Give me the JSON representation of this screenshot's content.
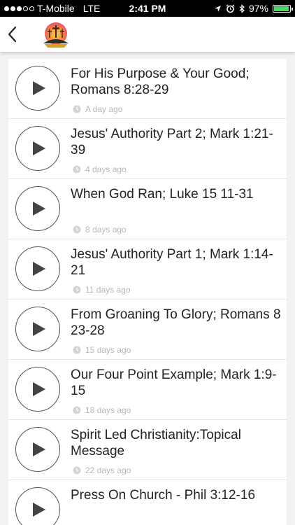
{
  "status_bar": {
    "carrier": "T-Mobile",
    "network": "LTE",
    "time": "2:41 PM",
    "battery_percent": "97%",
    "battery_level": 0.97,
    "icons": [
      "location-icon",
      "alarm-icon",
      "bluetooth-icon",
      "battery-icon"
    ]
  },
  "nav": {
    "back_icon": "chevron-left-icon",
    "logo": "church-logo"
  },
  "colors": {
    "play_border": "#555555",
    "list_background": "#f2f2f2",
    "meta_text": "#b8b8b8",
    "battery": "#4cd964"
  },
  "episodes": [
    {
      "title": "For His Purpose & Your Good; Romans 8:28-29",
      "age": "A day ago"
    },
    {
      "title": "Jesus' Authority Part 2; Mark 1:21-39",
      "age": "4 days ago"
    },
    {
      "title": "When God Ran; Luke 15 11-31",
      "age": "8 days ago"
    },
    {
      "title": "Jesus' Authority Part 1; Mark 1:14-21",
      "age": "11 days ago"
    },
    {
      "title": "From Groaning To Glory; Romans 8 23-28",
      "age": "15 days ago"
    },
    {
      "title": "Our Four Point Example; Mark 1:9-15",
      "age": "18 days ago"
    },
    {
      "title": "Spirit Led Christianity:Topical Message",
      "age": "22 days ago"
    },
    {
      "title": "Press On Church - Phil 3:12-16",
      "age": ""
    }
  ]
}
